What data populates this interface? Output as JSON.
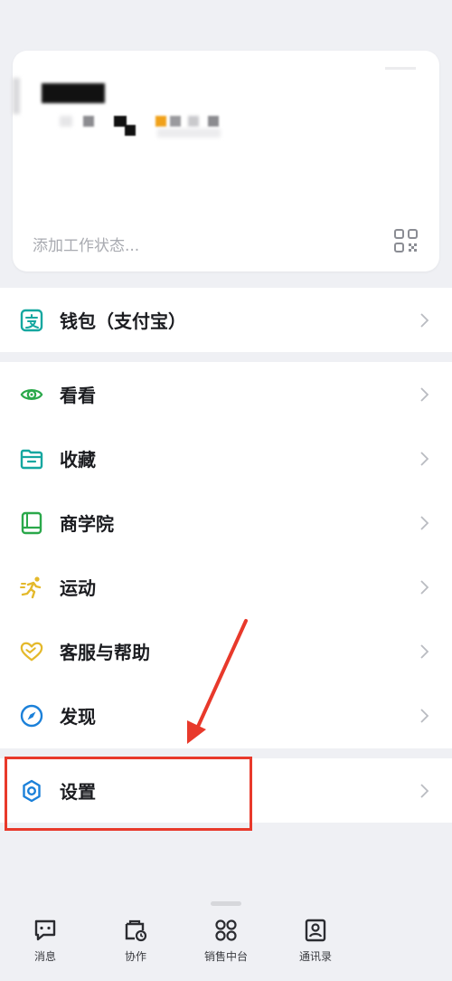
{
  "profile": {
    "status_placeholder": "添加工作状态..."
  },
  "menu": {
    "wallet": "钱包（支付宝）",
    "items": [
      "看看",
      "收藏",
      "商学院",
      "运动",
      "客服与帮助",
      "发现"
    ],
    "settings": "设置"
  },
  "tabbar": {
    "tabs": [
      "消息",
      "协作",
      "销售中台",
      "通讯录"
    ]
  },
  "colors": {
    "background": "#eff0f4",
    "card": "#ffffff",
    "teal": "#15a7a0",
    "green": "#2aa84a",
    "blue": "#1b80d9",
    "gold": "#e4b92b",
    "annotation": "#e8392b"
  },
  "icons": {
    "wallet": "alipay-icon",
    "look": "eye-icon",
    "favorites": "folder-icon",
    "school": "book-icon",
    "sport": "running-icon",
    "help": "heart-icon",
    "discover": "compass-icon",
    "settings": "gear-icon"
  }
}
